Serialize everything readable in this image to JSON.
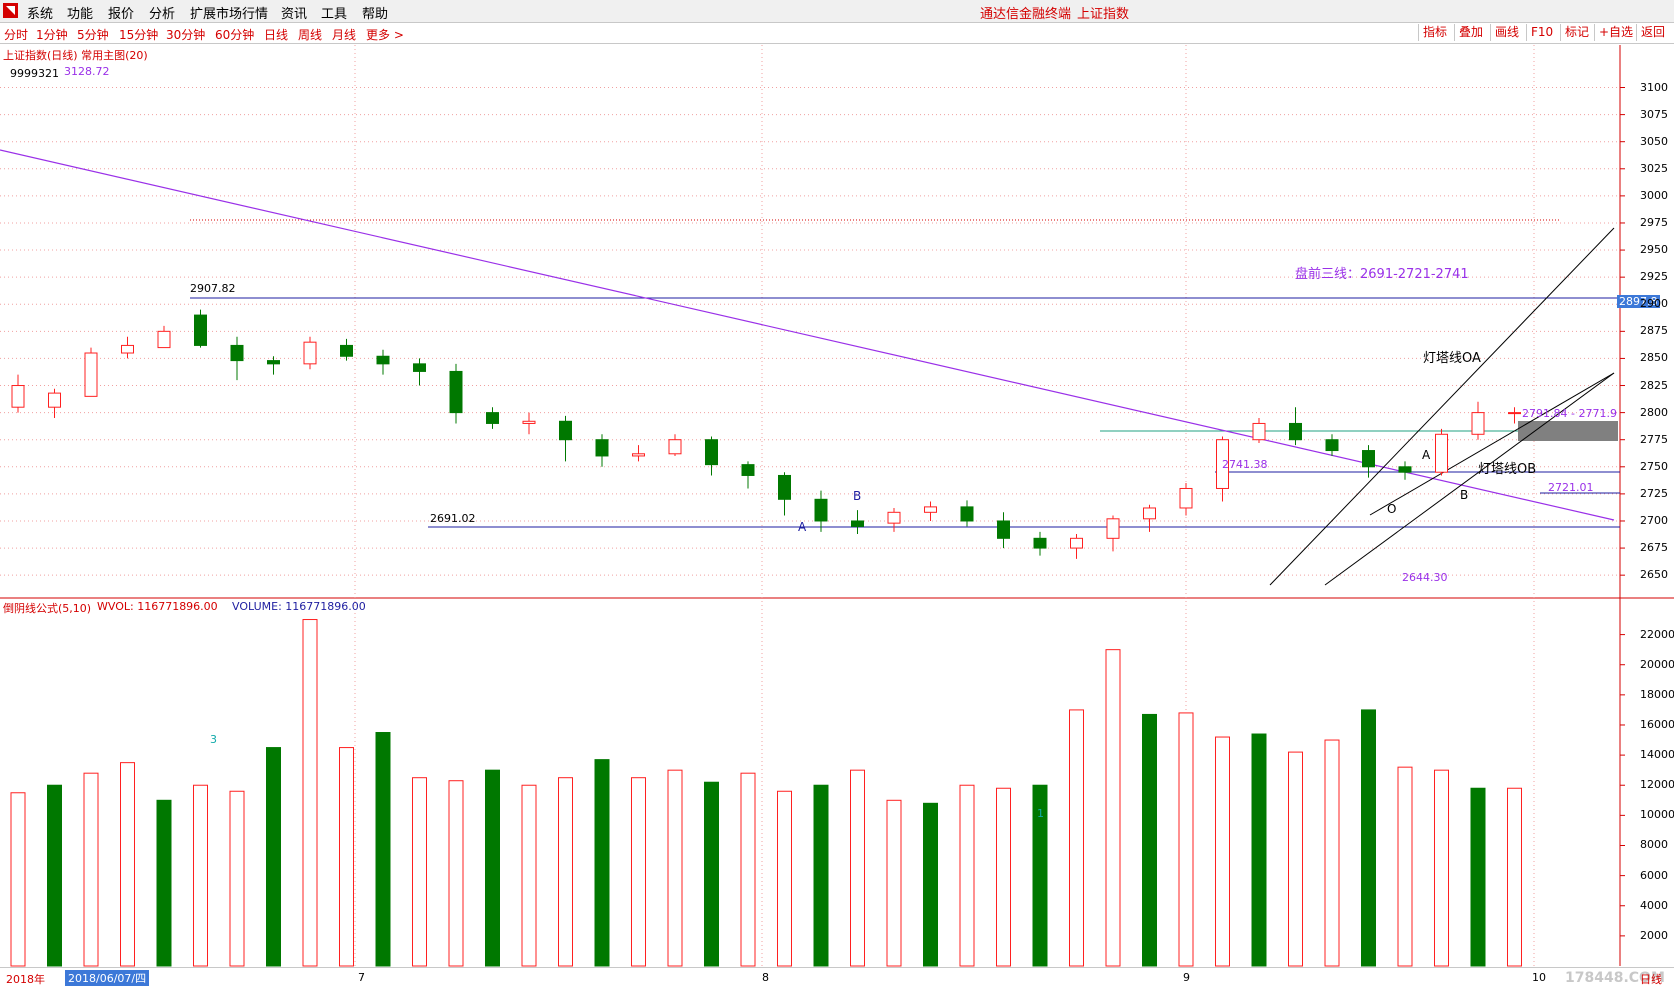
{
  "menubar": {
    "items": [
      "系统",
      "功能",
      "报价",
      "分析",
      "扩展市场行情",
      "资讯",
      "工具",
      "帮助"
    ],
    "app_title": "通达信金融终端",
    "index_title": "上证指数"
  },
  "toolbar": {
    "periods": [
      "分时",
      "1分钟",
      "5分钟",
      "15分钟",
      "30分钟",
      "60分钟",
      "日线",
      "周线",
      "月线",
      "更多 >"
    ],
    "buttons": [
      "指标",
      "叠加",
      "画线",
      "F10",
      "标记",
      "+自选",
      "返回"
    ]
  },
  "main_chart": {
    "title": "上证指数(日线) 常用主图(20)",
    "high_marker": "3128.72",
    "top_left_code": "9999321",
    "labels": {
      "level_2907": "2907.82",
      "level_2691": "2691.02",
      "level_2741": "2741.38",
      "level_2644": "2644.30",
      "level_2721": "2721.01",
      "range_label": "2791.84 - 2771.9",
      "premarket": "盘前三线：2691-2721-2741",
      "lighthouse_oa": "灯塔线OA",
      "lighthouse_ob": "灯塔线OB",
      "price_tag": "2897.8",
      "point_a1": "A",
      "point_b1": "B",
      "point_a2": "A",
      "point_b2": "B",
      "point_o": "O"
    },
    "y_ticks": [
      "3100",
      "3075",
      "3050",
      "3025",
      "3000",
      "2975",
      "2950",
      "2925",
      "2900",
      "2875",
      "2850",
      "2825",
      "2800",
      "2775",
      "2750",
      "2725",
      "2700",
      "2675",
      "2650"
    ]
  },
  "volume_chart": {
    "title": "倒阴线公式(5,10)",
    "wvol_label": "WVOL: 116771896.00",
    "volume_label": "VOLUME: 116771896.00",
    "y_ticks": [
      "22000",
      "20000",
      "18000",
      "16000",
      "14000",
      "12000",
      "10000",
      "8000",
      "6000",
      "4000",
      "2000"
    ],
    "marker_3": "3",
    "marker_1": "1"
  },
  "bottom": {
    "year": "2018年",
    "date_box": "2018/06/07/四",
    "months": [
      "7",
      "8",
      "9",
      "10"
    ],
    "period": "日线",
    "watermark": "178448.COM"
  },
  "colors": {
    "up": "#ff2020",
    "down": "#007800",
    "trend": "#9a30e8",
    "level": "#1e1ea0",
    "accent": "#d40000"
  },
  "chart_data": {
    "type": "candlestick",
    "candles": [
      [
        2805,
        2825,
        2800,
        2835
      ],
      [
        2805,
        2818,
        2795,
        2822
      ],
      [
        2815,
        2855,
        2815,
        2860
      ],
      [
        2855,
        2862,
        2850,
        2870
      ],
      [
        2860,
        2875,
        2860,
        2880
      ],
      [
        2890,
        2862,
        2860,
        2895
      ],
      [
        2862,
        2848,
        2830,
        2870
      ],
      [
        2848,
        2845,
        2835,
        2852
      ],
      [
        2845,
        2865,
        2840,
        2870
      ],
      [
        2862,
        2852,
        2848,
        2868
      ],
      [
        2852,
        2845,
        2835,
        2858
      ],
      [
        2845,
        2838,
        2825,
        2850
      ],
      [
        2838,
        2800,
        2790,
        2845
      ],
      [
        2800,
        2790,
        2785,
        2805
      ],
      [
        2790,
        2792,
        2780,
        2800
      ],
      [
        2792,
        2775,
        2755,
        2797
      ],
      [
        2775,
        2760,
        2750,
        2780
      ],
      [
        2760,
        2762,
        2755,
        2770
      ],
      [
        2762,
        2775,
        2760,
        2780
      ],
      [
        2775,
        2752,
        2742,
        2778
      ],
      [
        2752,
        2742,
        2730,
        2755
      ],
      [
        2742,
        2720,
        2705,
        2745
      ],
      [
        2720,
        2700,
        2690,
        2728
      ],
      [
        2700,
        2695,
        2688,
        2710
      ],
      [
        2698,
        2708,
        2690,
        2712
      ],
      [
        2708,
        2713,
        2700,
        2718
      ],
      [
        2713,
        2700,
        2695,
        2719
      ],
      [
        2700,
        2684,
        2675,
        2708
      ],
      [
        2684,
        2675,
        2668,
        2690
      ],
      [
        2675,
        2684,
        2665,
        2688
      ],
      [
        2684,
        2702,
        2672,
        2705
      ],
      [
        2702,
        2712,
        2690,
        2715
      ],
      [
        2712,
        2730,
        2705,
        2735
      ],
      [
        2730,
        2775,
        2718,
        2778
      ],
      [
        2775,
        2790,
        2772,
        2795
      ],
      [
        2790,
        2775,
        2770,
        2805
      ],
      [
        2775,
        2765,
        2760,
        2780
      ],
      [
        2765,
        2750,
        2740,
        2770
      ],
      [
        2750,
        2745,
        2738,
        2755
      ],
      [
        2745,
        2780,
        2742,
        2785
      ],
      [
        2780,
        2800,
        2775,
        2810
      ],
      [
        2800,
        2800,
        2790,
        2805
      ]
    ],
    "ylim": [
      2640,
      3130
    ]
  }
}
